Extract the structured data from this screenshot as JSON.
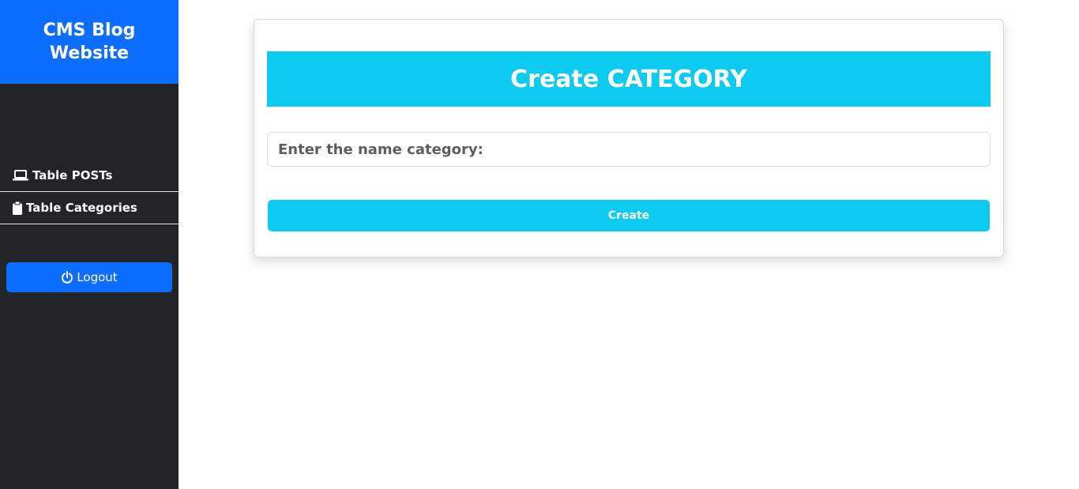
{
  "sidebar": {
    "brand": "CMS Blog Website",
    "items": [
      {
        "label": "Table POSTs",
        "icon": "laptop-icon"
      },
      {
        "label": "Table Categories",
        "icon": "clipboard-icon"
      }
    ],
    "logout_label": "Logout",
    "logout_icon": "power-icon"
  },
  "main": {
    "title": "Create CATEGORY",
    "name_placeholder": "Enter the name category:",
    "name_value": "",
    "create_label": "Create"
  },
  "colors": {
    "brand_blue": "#0d6efd",
    "sidebar_dark": "#212529",
    "accent_cyan": "#0dcaf0"
  }
}
